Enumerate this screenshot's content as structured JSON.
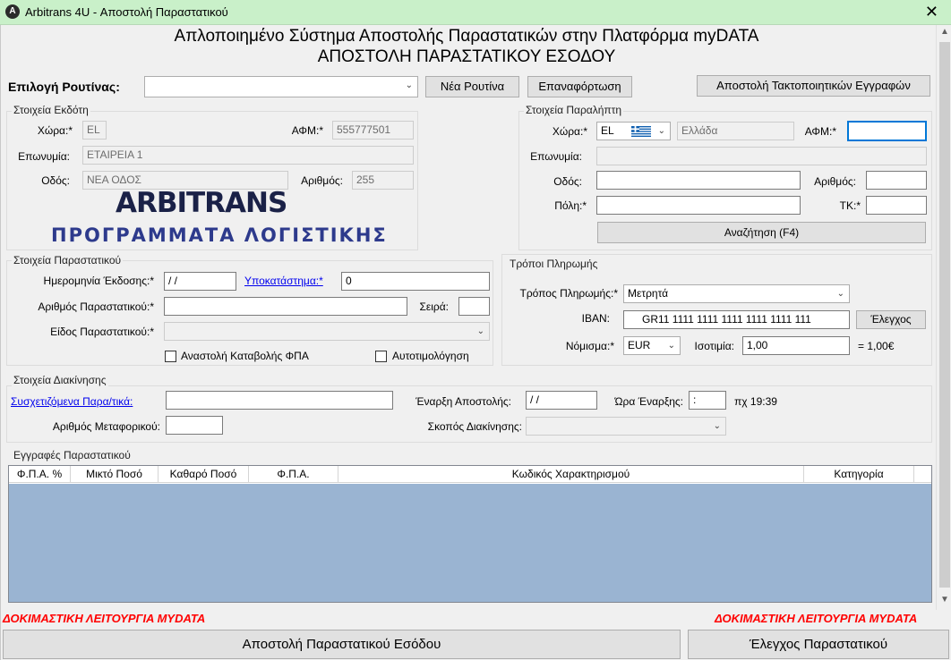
{
  "window": {
    "title": "Arbitrans 4U - Αποστολή Παραστατικού",
    "app_icon": "A",
    "close_glyph": "✕"
  },
  "header": {
    "line1": "Απλοποιημένο Σύστημα Αποστολής Παραστατικών στην Πλατφόρμα myDATA",
    "line2": "ΑΠΟΣΤΟΛΗ ΠΑΡΑΣΤΑΤΙΚΟΥ ΕΣΟΔΟΥ"
  },
  "routine": {
    "label": "Επιλογή Ρουτίνας:",
    "value": "",
    "new_button": "Νέα Ρουτίνα",
    "reload_button": "Επαναφόρτωση",
    "send_button": "Αποστολή Τακτοποιητικών Εγγραφών"
  },
  "issuer": {
    "title": "Στοιχεία Εκδότη",
    "country_label": "Χώρα:*",
    "country_value": "EL",
    "afm_label": "ΑΦΜ:*",
    "afm_value": "555777501",
    "name_label": "Επωνυμία:",
    "name_value": "ΕΤΑΙΡΕΙΑ 1",
    "street_label": "Οδός:",
    "street_value": "ΝΕΑ ΟΔΟΣ",
    "number_label": "Αριθμός:",
    "number_value": "255",
    "logo_line1": "ARBITRANS",
    "logo_line2": "ΠΡΟΓΡΑΜΜΑΤΑ ΛΟΓΙΣΤΙΚΗΣ"
  },
  "receiver": {
    "title": "Στοιχεία Παραλήπτη",
    "country_label": "Χώρα:*",
    "country_code": "EL",
    "country_name": "Ελλάδα",
    "afm_label": "ΑΦΜ:*",
    "afm_value": "",
    "name_label": "Επωνυμία:",
    "name_value": "",
    "street_label": "Οδός:",
    "street_value": "",
    "number_label": "Αριθμός:",
    "number_value": "",
    "city_label": "Πόλη:*",
    "city_value": "",
    "zip_label": "ΤΚ:*",
    "zip_value": "",
    "search_button": "Αναζήτηση (F4)"
  },
  "document": {
    "title": "Στοιχεία Παραστατικού",
    "date_label": "Ημερομηνία Έκδοσης:*",
    "date_value": " / /",
    "branch_label": "Υποκατάστημα:*",
    "branch_value": "0",
    "number_label": "Αριθμός Παραστατικού:*",
    "number_value": "",
    "series_label": "Σειρά:",
    "series_value": "",
    "type_label": "Είδος Παραστατικού:*",
    "type_value": "",
    "vat_suspension": "Αναστολή Καταβολής ΦΠΑ",
    "self_invoicing": "Αυτοτιμολόγηση"
  },
  "payment": {
    "title": "Τρόποι Πληρωμής",
    "method_label": "Τρόπος Πληρωμής:*",
    "method_value": "Μετρητά",
    "iban_label": "IBAN:",
    "iban_value": "GR11 1111 1111 1111 1111 1111 111",
    "check_button": "Έλεγχος",
    "currency_label": "Νόμισμα:*",
    "currency_value": "EUR",
    "rate_label": "Ισοτιμία:",
    "rate_value": "1,00",
    "rate_result": "= 1,00€"
  },
  "transport": {
    "title": "Στοιχεία Διακίνησης",
    "related_label": "Συσχετιζόμενα Παρα/τικά:",
    "related_value": "",
    "start_label": "Έναρξη Αποστολής:",
    "start_value": " / /",
    "time_label": "Ώρα Έναρξης:",
    "time_value": " :",
    "time_hint": "πχ 19:39",
    "vehicle_label": "Αριθμός Μεταφορικού:",
    "vehicle_value": "",
    "purpose_label": "Σκοπός Διακίνησης:",
    "purpose_value": ""
  },
  "entries": {
    "title": "Εγγραφές Παραστατικού",
    "columns": [
      "Φ.Π.Α. %",
      "Μικτό Ποσό",
      "Καθαρό Ποσό",
      "Φ.Π.Α.",
      "Κωδικός Χαρακτηρισμού",
      "Κατηγορία"
    ]
  },
  "footer": {
    "test_mode_left": "ΔΟΚΙΜΑΣΤΙΚΗ ΛΕΙΤΟΥΡΓΙΑ MYDATA",
    "test_mode_right": "ΔΟΚΙΜΑΣΤΙΚΗ ΛΕΙΤΟΥΡΓΙΑ MYDATA",
    "send_button": "Αποστολή Παραστατικού Εσόδου",
    "check_button": "Έλεγχος Παραστατικού"
  },
  "colors": {
    "titlebar": "#c9f0c9",
    "grid_body": "#9ab4d2",
    "link": "#0000ee",
    "warning": "#ff0000"
  }
}
